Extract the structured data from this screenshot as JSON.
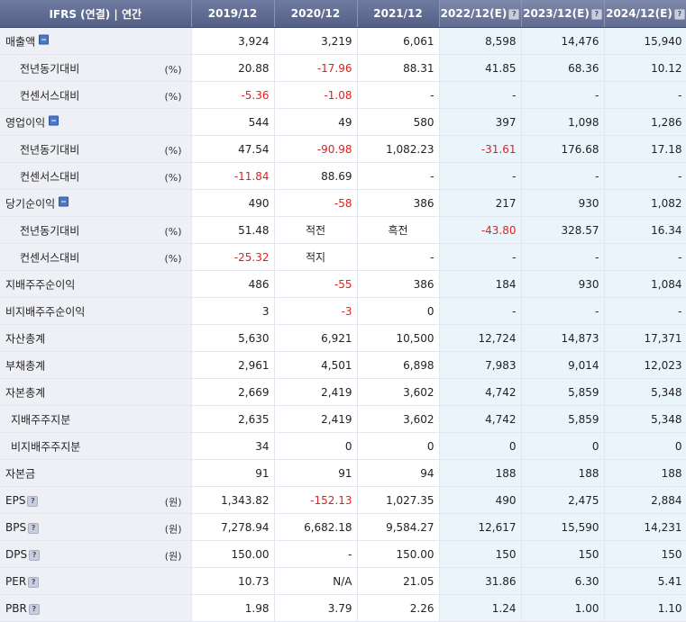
{
  "header": {
    "label": "IFRS (연결) | 연간",
    "years": [
      "2019/12",
      "2020/12",
      "2021/12",
      "2022/12(E)",
      "2023/12(E)",
      "2024/12(E)"
    ],
    "estimate_flags": [
      false,
      false,
      false,
      true,
      true,
      true
    ]
  },
  "rows": [
    {
      "label": "매출액",
      "indent": 0,
      "unit": "",
      "toggle": true,
      "help": false,
      "values": [
        "3,924",
        "3,219",
        "6,061",
        "8,598",
        "14,476",
        "15,940"
      ]
    },
    {
      "label": "전년동기대비",
      "indent": 1,
      "unit": "(%)",
      "toggle": false,
      "help": false,
      "values": [
        "20.88",
        "-17.96",
        "88.31",
        "41.85",
        "68.36",
        "10.12"
      ]
    },
    {
      "label": "컨센서스대비",
      "indent": 1,
      "unit": "(%)",
      "toggle": false,
      "help": false,
      "values": [
        "-5.36",
        "-1.08",
        "-",
        "-",
        "-",
        "-"
      ]
    },
    {
      "label": "영업이익",
      "indent": 0,
      "unit": "",
      "toggle": true,
      "help": false,
      "values": [
        "544",
        "49",
        "580",
        "397",
        "1,098",
        "1,286"
      ]
    },
    {
      "label": "전년동기대비",
      "indent": 1,
      "unit": "(%)",
      "toggle": false,
      "help": false,
      "values": [
        "47.54",
        "-90.98",
        "1,082.23",
        "-31.61",
        "176.68",
        "17.18"
      ]
    },
    {
      "label": "컨센서스대비",
      "indent": 1,
      "unit": "(%)",
      "toggle": false,
      "help": false,
      "values": [
        "-11.84",
        "88.69",
        "-",
        "-",
        "-",
        "-"
      ]
    },
    {
      "label": "당기순이익",
      "indent": 0,
      "unit": "",
      "toggle": true,
      "help": false,
      "values": [
        "490",
        "-58",
        "386",
        "217",
        "930",
        "1,082"
      ]
    },
    {
      "label": "전년동기대비",
      "indent": 1,
      "unit": "(%)",
      "toggle": false,
      "help": false,
      "values": [
        "51.48",
        "적전",
        "흑전",
        "-43.80",
        "328.57",
        "16.34"
      ]
    },
    {
      "label": "컨센서스대비",
      "indent": 1,
      "unit": "(%)",
      "toggle": false,
      "help": false,
      "values": [
        "-25.32",
        "적지",
        "-",
        "-",
        "-",
        "-"
      ]
    },
    {
      "label": "지배주주순이익",
      "indent": 0,
      "unit": "",
      "toggle": false,
      "help": false,
      "values": [
        "486",
        "-55",
        "386",
        "184",
        "930",
        "1,084"
      ]
    },
    {
      "label": "비지배주주순이익",
      "indent": 0,
      "unit": "",
      "toggle": false,
      "help": false,
      "values": [
        "3",
        "-3",
        "0",
        "-",
        "-",
        "-"
      ]
    },
    {
      "label": "자산총계",
      "indent": 0,
      "unit": "",
      "toggle": false,
      "help": false,
      "values": [
        "5,630",
        "6,921",
        "10,500",
        "12,724",
        "14,873",
        "17,371"
      ]
    },
    {
      "label": "부채총계",
      "indent": 0,
      "unit": "",
      "toggle": false,
      "help": false,
      "values": [
        "2,961",
        "4,501",
        "6,898",
        "7,983",
        "9,014",
        "12,023"
      ]
    },
    {
      "label": "자본총계",
      "indent": 0,
      "unit": "",
      "toggle": false,
      "help": false,
      "values": [
        "2,669",
        "2,419",
        "3,602",
        "4,742",
        "5,859",
        "5,348"
      ]
    },
    {
      "label": "지배주주지분",
      "indent": 2,
      "unit": "",
      "toggle": false,
      "help": false,
      "values": [
        "2,635",
        "2,419",
        "3,602",
        "4,742",
        "5,859",
        "5,348"
      ]
    },
    {
      "label": "비지배주주지분",
      "indent": 2,
      "unit": "",
      "toggle": false,
      "help": false,
      "values": [
        "34",
        "0",
        "0",
        "0",
        "0",
        "0"
      ]
    },
    {
      "label": "자본금",
      "indent": 0,
      "unit": "",
      "toggle": false,
      "help": false,
      "values": [
        "91",
        "91",
        "94",
        "188",
        "188",
        "188"
      ]
    },
    {
      "label": "EPS",
      "indent": 0,
      "unit": "(원)",
      "toggle": false,
      "help": true,
      "values": [
        "1,343.82",
        "-152.13",
        "1,027.35",
        "490",
        "2,475",
        "2,884"
      ]
    },
    {
      "label": "BPS",
      "indent": 0,
      "unit": "(원)",
      "toggle": false,
      "help": true,
      "values": [
        "7,278.94",
        "6,682.18",
        "9,584.27",
        "12,617",
        "15,590",
        "14,231"
      ]
    },
    {
      "label": "DPS",
      "indent": 0,
      "unit": "(원)",
      "toggle": false,
      "help": true,
      "values": [
        "150.00",
        "-",
        "150.00",
        "150",
        "150",
        "150"
      ]
    },
    {
      "label": "PER",
      "indent": 0,
      "unit": "",
      "toggle": false,
      "help": true,
      "values": [
        "10.73",
        "N/A",
        "21.05",
        "31.86",
        "6.30",
        "5.41"
      ]
    },
    {
      "label": "PBR",
      "indent": 0,
      "unit": "",
      "toggle": false,
      "help": true,
      "values": [
        "1.98",
        "3.79",
        "2.26",
        "1.24",
        "1.00",
        "1.10"
      ]
    }
  ],
  "colors": {
    "negative": "#e02020",
    "estimate_bg": "#e9f5fb",
    "label_bg": "#eef0f5",
    "header_bg": "#5d6990"
  }
}
